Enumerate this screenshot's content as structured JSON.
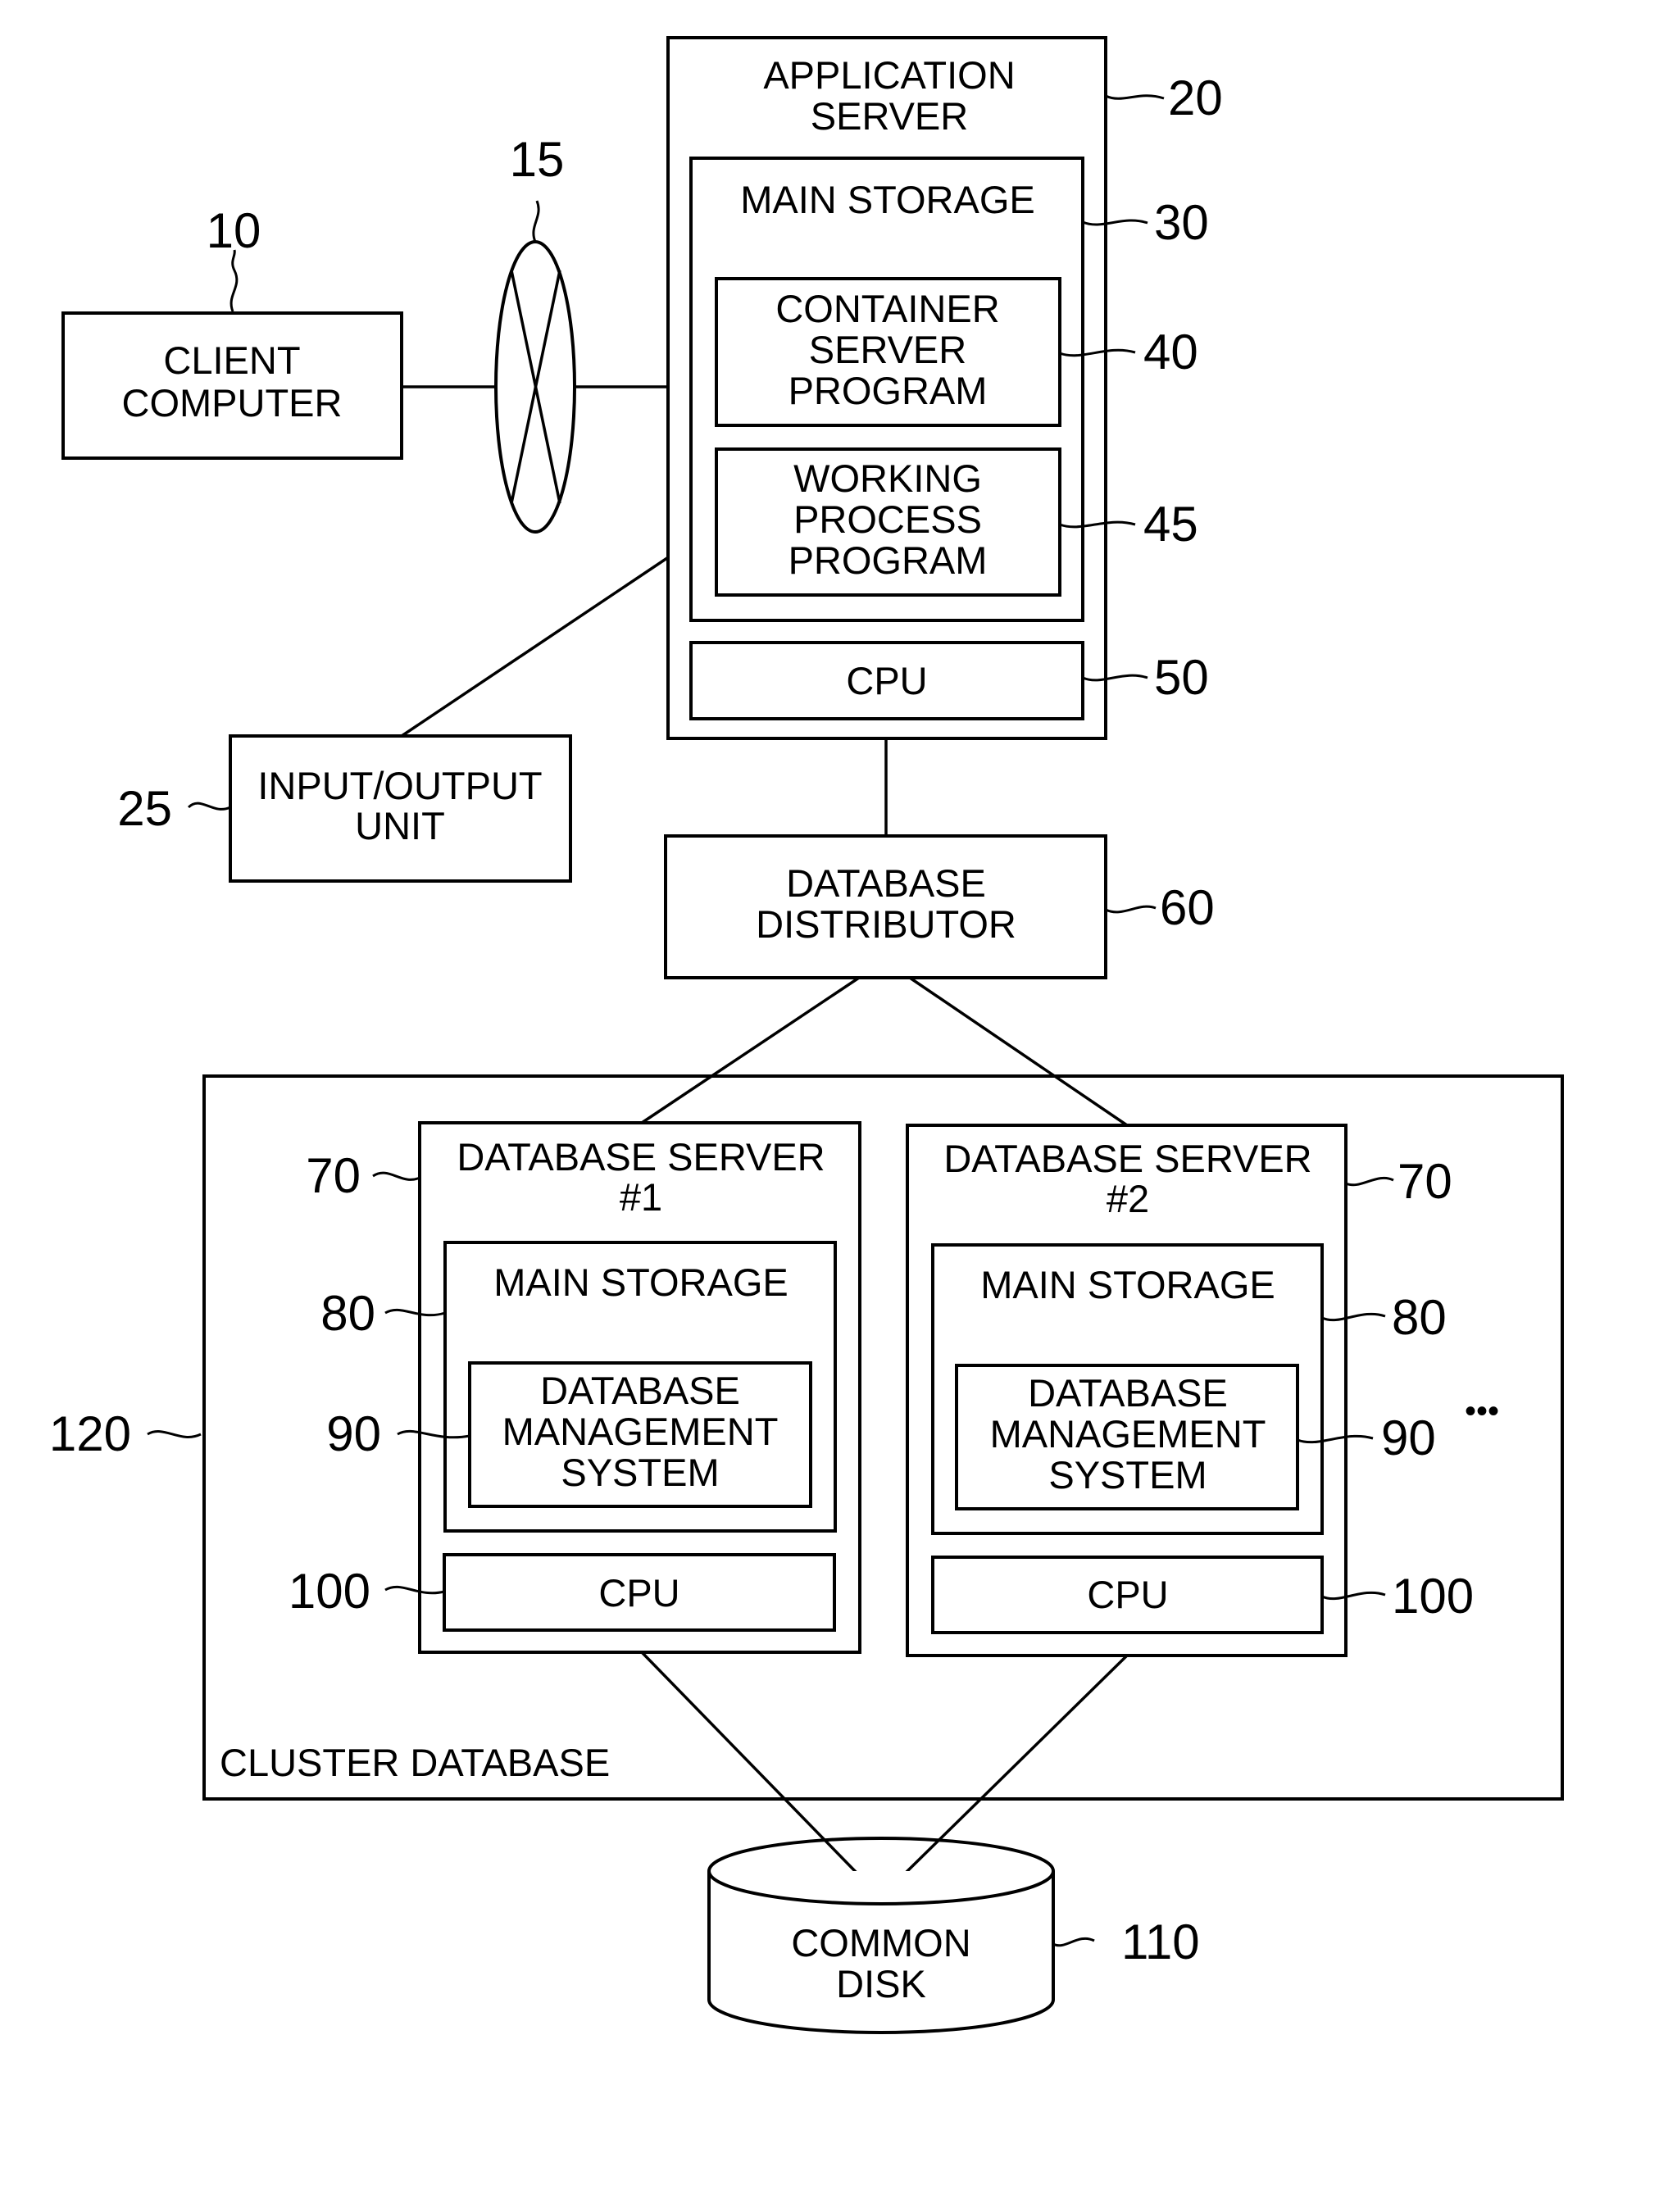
{
  "diagram": {
    "client": {
      "lines": [
        "CLIENT",
        "COMPUTER"
      ],
      "ref": "10"
    },
    "network": {
      "ref": "15"
    },
    "app_server": {
      "lines": [
        "APPLICATION",
        "SERVER"
      ],
      "ref": "20"
    },
    "main_storage": {
      "lines": [
        "MAIN STORAGE"
      ],
      "ref": "30"
    },
    "container": {
      "lines": [
        "CONTAINER",
        "SERVER",
        "PROGRAM"
      ],
      "ref": "40"
    },
    "working": {
      "lines": [
        "WORKING",
        "PROCESS",
        "PROGRAM"
      ],
      "ref": "45"
    },
    "app_cpu": {
      "lines": [
        "CPU"
      ],
      "ref": "50"
    },
    "io_unit": {
      "lines": [
        "INPUT/OUTPUT",
        "UNIT"
      ],
      "ref": "25"
    },
    "distributor": {
      "lines": [
        "DATABASE",
        "DISTRIBUTOR"
      ],
      "ref": "60"
    },
    "cluster": {
      "label": "CLUSTER DATABASE",
      "ref": "120"
    },
    "db_servers": [
      {
        "lines": [
          "DATABASE SERVER",
          "#1"
        ],
        "ref": "70",
        "storage": {
          "lines": [
            "MAIN STORAGE"
          ],
          "ref": "80"
        },
        "dbms": {
          "lines": [
            "DATABASE",
            "MANAGEMENT",
            "SYSTEM"
          ],
          "ref": "90"
        },
        "cpu": {
          "lines": [
            "CPU"
          ],
          "ref": "100"
        }
      },
      {
        "lines": [
          "DATABASE SERVER",
          "#2"
        ],
        "ref": "70",
        "storage": {
          "lines": [
            "MAIN STORAGE"
          ],
          "ref": "80"
        },
        "dbms": {
          "lines": [
            "DATABASE",
            "MANAGEMENT",
            "SYSTEM"
          ],
          "ref": "90"
        },
        "cpu": {
          "lines": [
            "CPU"
          ],
          "ref": "100"
        }
      }
    ],
    "ellipsis": "•••",
    "common_disk": {
      "lines": [
        "COMMON",
        "DISK"
      ],
      "ref": "110"
    }
  }
}
